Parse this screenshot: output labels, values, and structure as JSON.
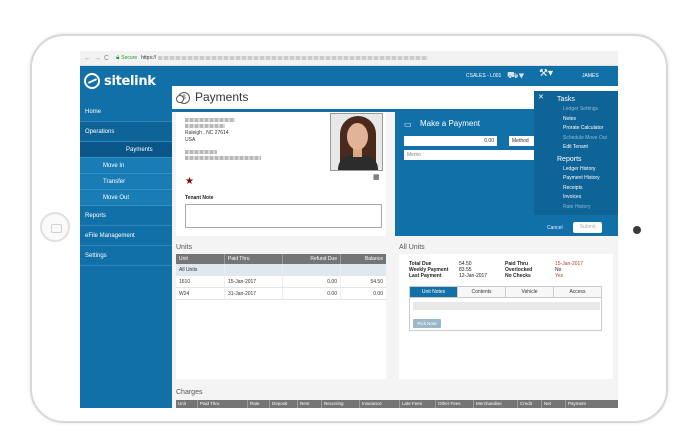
{
  "browser": {
    "secure_label": "Secure",
    "url_prefix": "https://"
  },
  "brand": {
    "name": "sitelink",
    "accent": "#1170a8"
  },
  "sidebar": {
    "items": [
      {
        "label": "Home"
      },
      {
        "label": "Operations"
      },
      {
        "label": "Reports"
      },
      {
        "label": "eFile Management"
      },
      {
        "label": "Settings"
      }
    ],
    "sub_items": [
      {
        "label": "Payments"
      },
      {
        "label": "Move In"
      },
      {
        "label": "Transfer"
      },
      {
        "label": "Move Out"
      }
    ]
  },
  "topbar": {
    "location": "CSALES - L001",
    "user": "JAMES"
  },
  "page": {
    "title": "Payments"
  },
  "tenant": {
    "city_line": "Raleigh , NC 27614",
    "country": "USA",
    "note_label": "Tenant Note"
  },
  "payment": {
    "title": "Make a Payment",
    "t_label": "T",
    "amount": "0.00",
    "method_label": "Method",
    "memo_placeholder": "Memo",
    "cancel_label": "Cancel",
    "submit_label": "Submit"
  },
  "menu": {
    "tasks_heading": "Tasks",
    "tasks": [
      "Ledger Settings",
      "Notes",
      "Prorate Calculator",
      "Schedule Move Out",
      "Edit Tenant"
    ],
    "reports_heading": "Reports",
    "reports": [
      "Ledger History",
      "Payment History",
      "Receipts",
      "Invoices",
      "Rate History"
    ]
  },
  "units": {
    "title": "Units",
    "columns": [
      "Unit",
      "Paid Thru",
      "Refund Due",
      "Balance"
    ],
    "all_units_label": "All Units",
    "rows": [
      {
        "unit": "1610",
        "paid_thru": "15-Jan-2017",
        "refund_due": "0.00",
        "balance": "54.50"
      },
      {
        "unit": "W24",
        "paid_thru": "31-Jan-2017",
        "refund_due": "0.00",
        "balance": "0.00"
      }
    ]
  },
  "all_units": {
    "title": "All Units",
    "total_due_label": "Total Due",
    "total_due": "54.50",
    "weekly_label": "Weekly Payment",
    "weekly": "83.55",
    "last_label": "Last Payment",
    "last": "12-Jan-2017",
    "paid_thru_label": "Paid Thru",
    "paid_thru": "15-Jan-2017",
    "overlocked_label": "Overlocked",
    "overlocked": "No",
    "nochecks_label": "No Checks",
    "nochecks": "Yes",
    "tabs": [
      "Unit Notes",
      "Contents",
      "Vehicle",
      "Access"
    ],
    "pick_note": "Pick Note"
  },
  "charges": {
    "title": "Charges",
    "columns": [
      "Unit",
      "Paid Thru",
      "Rate",
      "Deposit",
      "Rent",
      "Recurring",
      "Insurance",
      "Late Fees",
      "Other Fees",
      "Merchandise",
      "Credit",
      "Net",
      "Payment"
    ]
  }
}
